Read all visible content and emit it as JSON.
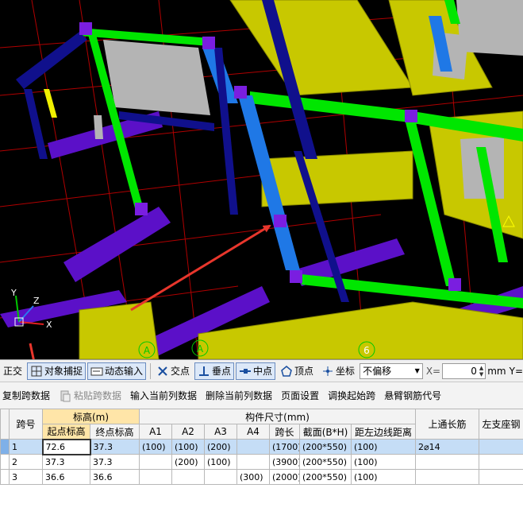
{
  "viewport": {
    "axis_labels": [
      "Y",
      "X",
      "Z"
    ],
    "grid_markers": [
      "A",
      "A",
      "6"
    ]
  },
  "snap_toolbar": {
    "ortho": "正交",
    "object_snap": "对象捕捉",
    "dynamic_input": "动态输入",
    "intersection": "交点",
    "perpendicular": "垂点",
    "midpoint": "中点",
    "vertex": "顶点",
    "coordinate": "坐标",
    "offset_mode": "不偏移",
    "x_label": "X=",
    "x_value": "0",
    "unit": "mm",
    "y_label": "Y="
  },
  "action_toolbar": {
    "copy_span": "复制跨数据",
    "paste_span": "粘贴跨数据",
    "input_column": "输入当前列数据",
    "delete_column": "删除当前列数据",
    "page_setup": "页面设置",
    "adjust_start_span": "调换起始跨",
    "cantilever_code": "悬臂钢筋代号"
  },
  "table": {
    "span_header": "跨号",
    "elevation_group": "标高(m)",
    "size_group": "构件尺寸(mm)",
    "top_rebar_header": "上通长筋",
    "left_support_header": "左支座钢",
    "columns": [
      "起点标高",
      "终点标高",
      "A1",
      "A2",
      "A3",
      "A4",
      "跨长",
      "截面(B*H)",
      "距左边线距离"
    ],
    "rows": [
      {
        "span": "1",
        "start": "72.6",
        "end": "37.3",
        "a1": "(100)",
        "a2": "(100)",
        "a3": "(200)",
        "a4": "",
        "length": "(1700)",
        "section": "(200*550)",
        "dist": "(100)",
        "top_rebar": "2⌀14",
        "left": ""
      },
      {
        "span": "2",
        "start": "37.3",
        "end": "37.3",
        "a1": "",
        "a2": "(200)",
        "a3": "(100)",
        "a4": "",
        "length": "(3900)",
        "section": "(200*550)",
        "dist": "(100)",
        "top_rebar": "",
        "left": ""
      },
      {
        "span": "3",
        "start": "36.6",
        "end": "36.6",
        "a1": "",
        "a2": "",
        "a3": "",
        "a4": "(300)",
        "length": "(2000)",
        "section": "(200*550)",
        "dist": "(100)",
        "top_rebar": "",
        "left": ""
      }
    ]
  },
  "colors": {
    "beam_green": "#00e600",
    "beam_purple": "#7a1ee0",
    "beam_blue": "#1f78e6",
    "slab_yellow": "#c8c800",
    "annotation_red": "#e8362c",
    "selected_row": "#c5ddf6"
  }
}
